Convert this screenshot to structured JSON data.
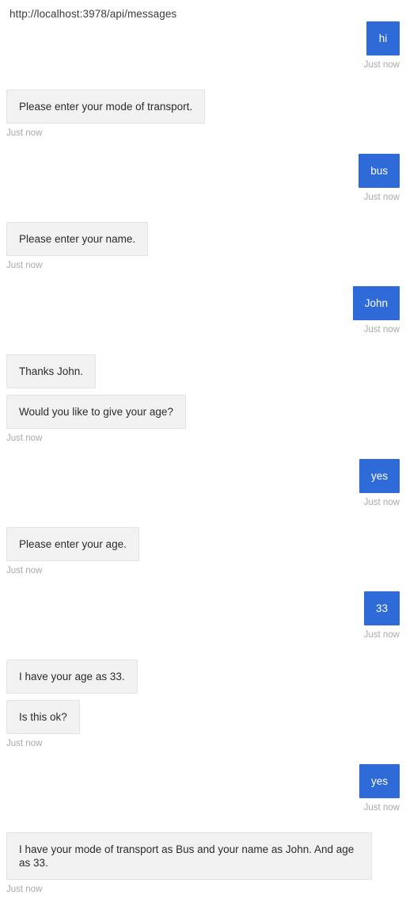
{
  "header": {
    "endpoint_url": "http://localhost:3978/api/messages"
  },
  "theme": {
    "user_bubble_color": "#2f6ad9",
    "user_text_color": "#ffffff",
    "bot_bubble_color": "#f2f2f2",
    "bot_border_color": "#e3e3e3",
    "bot_text_color": "#2b2b2b",
    "timestamp_color": "#a9a9a9",
    "page_background": "#ffffff"
  },
  "transcript": {
    "turns": [
      {
        "from": "user",
        "messages": [
          "hi"
        ],
        "timestamp": "Just now"
      },
      {
        "from": "bot",
        "messages": [
          "Please enter your mode of transport."
        ],
        "timestamp": "Just now"
      },
      {
        "from": "user",
        "messages": [
          "bus"
        ],
        "timestamp": "Just now"
      },
      {
        "from": "bot",
        "messages": [
          "Please enter your name."
        ],
        "timestamp": "Just now"
      },
      {
        "from": "user",
        "messages": [
          "John"
        ],
        "timestamp": "Just now"
      },
      {
        "from": "bot",
        "messages": [
          "Thanks John.",
          "Would you like to give your age?"
        ],
        "timestamp": "Just now"
      },
      {
        "from": "user",
        "messages": [
          "yes"
        ],
        "timestamp": "Just now"
      },
      {
        "from": "bot",
        "messages": [
          "Please enter your age."
        ],
        "timestamp": "Just now"
      },
      {
        "from": "user",
        "messages": [
          "33"
        ],
        "timestamp": "Just now"
      },
      {
        "from": "bot",
        "messages": [
          "I have your age as 33.",
          "Is this ok?"
        ],
        "timestamp": "Just now"
      },
      {
        "from": "user",
        "messages": [
          "yes"
        ],
        "timestamp": "Just now"
      },
      {
        "from": "bot",
        "messages": [
          "I have your mode of transport as Bus and your name as John. And age as 33."
        ],
        "timestamp": "Just now"
      }
    ]
  }
}
